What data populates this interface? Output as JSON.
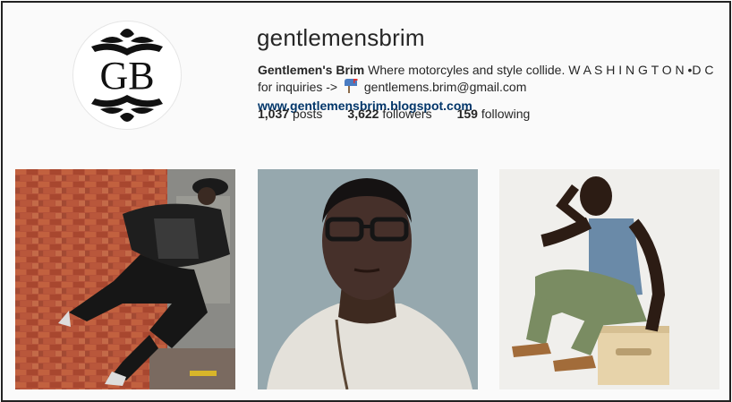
{
  "profile": {
    "avatar_text": "GB",
    "username": "gentlemensbrim",
    "full_name": "Gentlemen's Brim",
    "bio_text": "Where motorcyles and style collide. W A S H I N G T O N •D C for inquiries ->",
    "email": "gentlemens.brim@gmail.com",
    "website": "www.gentlemensbrim.blogspot.com"
  },
  "stats": {
    "posts_count": "1,037",
    "posts_label": "posts",
    "followers_count": "3,622",
    "followers_label": "followers",
    "following_count": "159",
    "following_label": "following"
  },
  "icons": {
    "mailbox": "mailbox-icon"
  },
  "colors": {
    "text": "#262626",
    "link": "#003569",
    "background": "#fafafa"
  }
}
